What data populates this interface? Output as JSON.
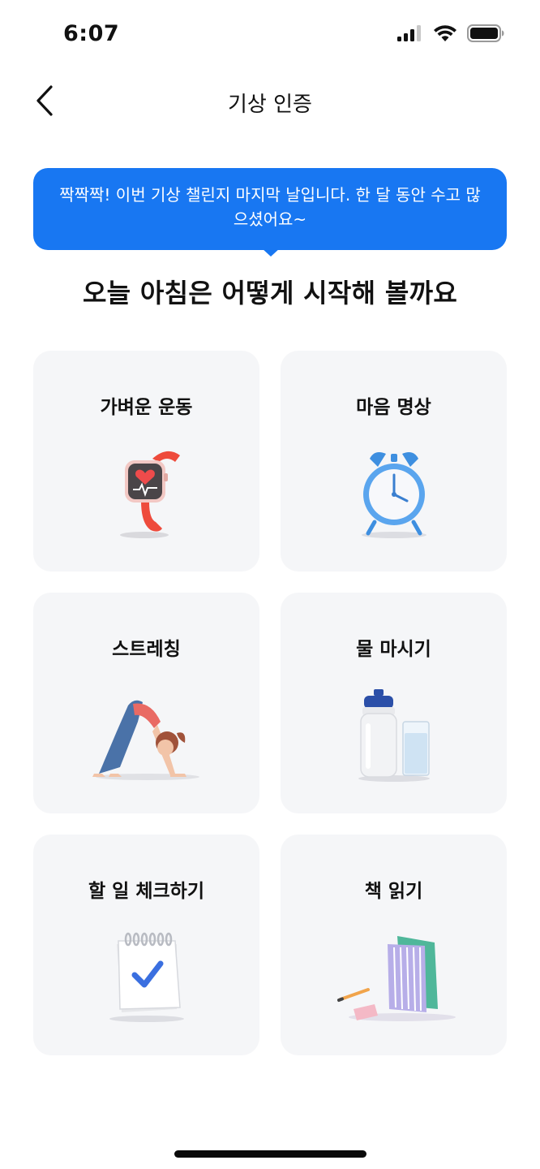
{
  "status_bar": {
    "time": "6:07"
  },
  "nav": {
    "title": "기상 인증"
  },
  "bubble": {
    "message": "짝짝짝! 이번 기상 챌린지 마지막 날입니다. 한 달 동안 수고 많으셨어요~"
  },
  "headline": "오늘 아침은 어떻게 시작해 볼까요",
  "options": [
    {
      "label": "가벼운 운동",
      "icon": "smartwatch-icon"
    },
    {
      "label": "마음 명상",
      "icon": "alarm-clock-icon"
    },
    {
      "label": "스트레칭",
      "icon": "yoga-pose-icon"
    },
    {
      "label": "물 마시기",
      "icon": "water-bottle-icon"
    },
    {
      "label": "할 일 체크하기",
      "icon": "calendar-check-icon"
    },
    {
      "label": "책 읽기",
      "icon": "books-icon"
    }
  ],
  "colors": {
    "accent": "#1877f2",
    "card_bg": "#f5f6f8",
    "text": "#111111"
  }
}
